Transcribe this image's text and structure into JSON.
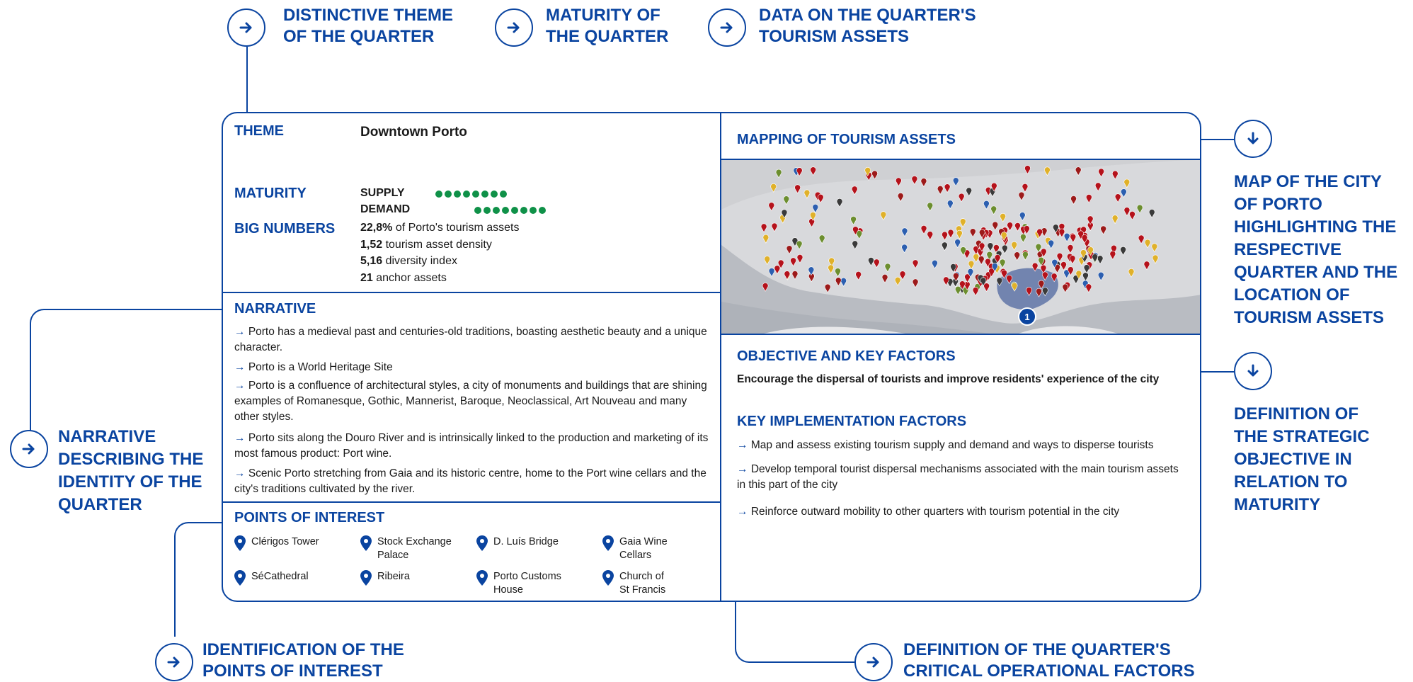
{
  "callouts": {
    "theme": "DISTINCTIVE THEME OF THE QUARTER",
    "maturity": "MATURITY OF THE QUARTER",
    "data": "DATA ON THE QUARTER'S TOURISM ASSETS",
    "map": "MAP OF THE CITY OF PORTO HIGHLIGHTING THE RESPECTIVE QUARTER AND THE LOCATION OF TOURISM ASSETS",
    "strategic": "DEFINITION OF THE STRATEGIC OBJECTIVE IN RELATION TO MATURITY",
    "narrative": "NARRATIVE DESCRIBING THE IDENTITY OF THE QUARTER",
    "poi": "IDENTIFICATION OF THE POINTS OF INTEREST",
    "critical": "DEFINITION OF THE QUARTER'S CRITICAL OPERATIONAL FACTORS"
  },
  "card": {
    "theme_label": "THEME",
    "theme_value": "Downtown Porto",
    "maturity_label": "MATURITY",
    "supply_label": "SUPPLY",
    "supply_dots": 8,
    "demand_label": "DEMAND",
    "demand_dots": 8,
    "big_numbers_label": "BIG NUMBERS",
    "big_numbers": [
      {
        "value": "22,8%",
        "text": " of Porto's tourism assets"
      },
      {
        "value": "1,52",
        "text": " tourism asset density"
      },
      {
        "value": "5,16",
        "text": " diversity index"
      },
      {
        "value": "21",
        "text": " anchor assets"
      }
    ],
    "narrative_label": "NARRATIVE",
    "narrative": [
      "Porto has a medieval past and centuries-old traditions, boasting aesthetic beauty and a unique character.",
      "Porto is a World Heritage Site",
      "Porto is a confluence of architectural styles, a city of monuments and buildings that are shining examples of Romanesque, Gothic, Mannerist, Baroque, Neoclassical, Art Nouveau and many other styles.",
      "Porto sits along the Douro River and is intrinsically linked to the production and marketing of its most famous product: Port wine.",
      "Scenic Porto stretching from Gaia and its historic centre, home to the Port wine cellars and the city's traditions cultivated by the river."
    ],
    "poi_label": "POINTS OF INTEREST",
    "poi": [
      [
        "Clérigos Tower"
      ],
      [
        "Stock Exchange",
        "Palace"
      ],
      [
        "D. Luís Bridge"
      ],
      [
        "Gaia Wine",
        "Cellars"
      ],
      [
        "SéCathedral"
      ],
      [
        "Ribeira"
      ],
      [
        "Porto Customs",
        "House"
      ],
      [
        "Church of",
        "St Francis"
      ]
    ],
    "mapping_label": "MAPPING OF TOURISM ASSETS",
    "map_marker": "1",
    "objective_label": "OBJECTIVE AND KEY FACTORS",
    "objective_text": "Encourage the dispersal of tourists and improve residents' experience of the city",
    "kif_label": "KEY IMPLEMENTATION FACTORS",
    "kif": [
      "Map and assess existing tourism supply and demand and ways to disperse tourists",
      "Develop temporal tourist dispersal mechanisms associated with the main tourism assets in this part of the city",
      "Reinforce outward mobility to other quarters with tourism potential in the city"
    ],
    "arrow_glyph": "→"
  },
  "colors": {
    "accent": "#0a44a0",
    "dot": "#0f9148",
    "pin": "#0a44a0"
  }
}
